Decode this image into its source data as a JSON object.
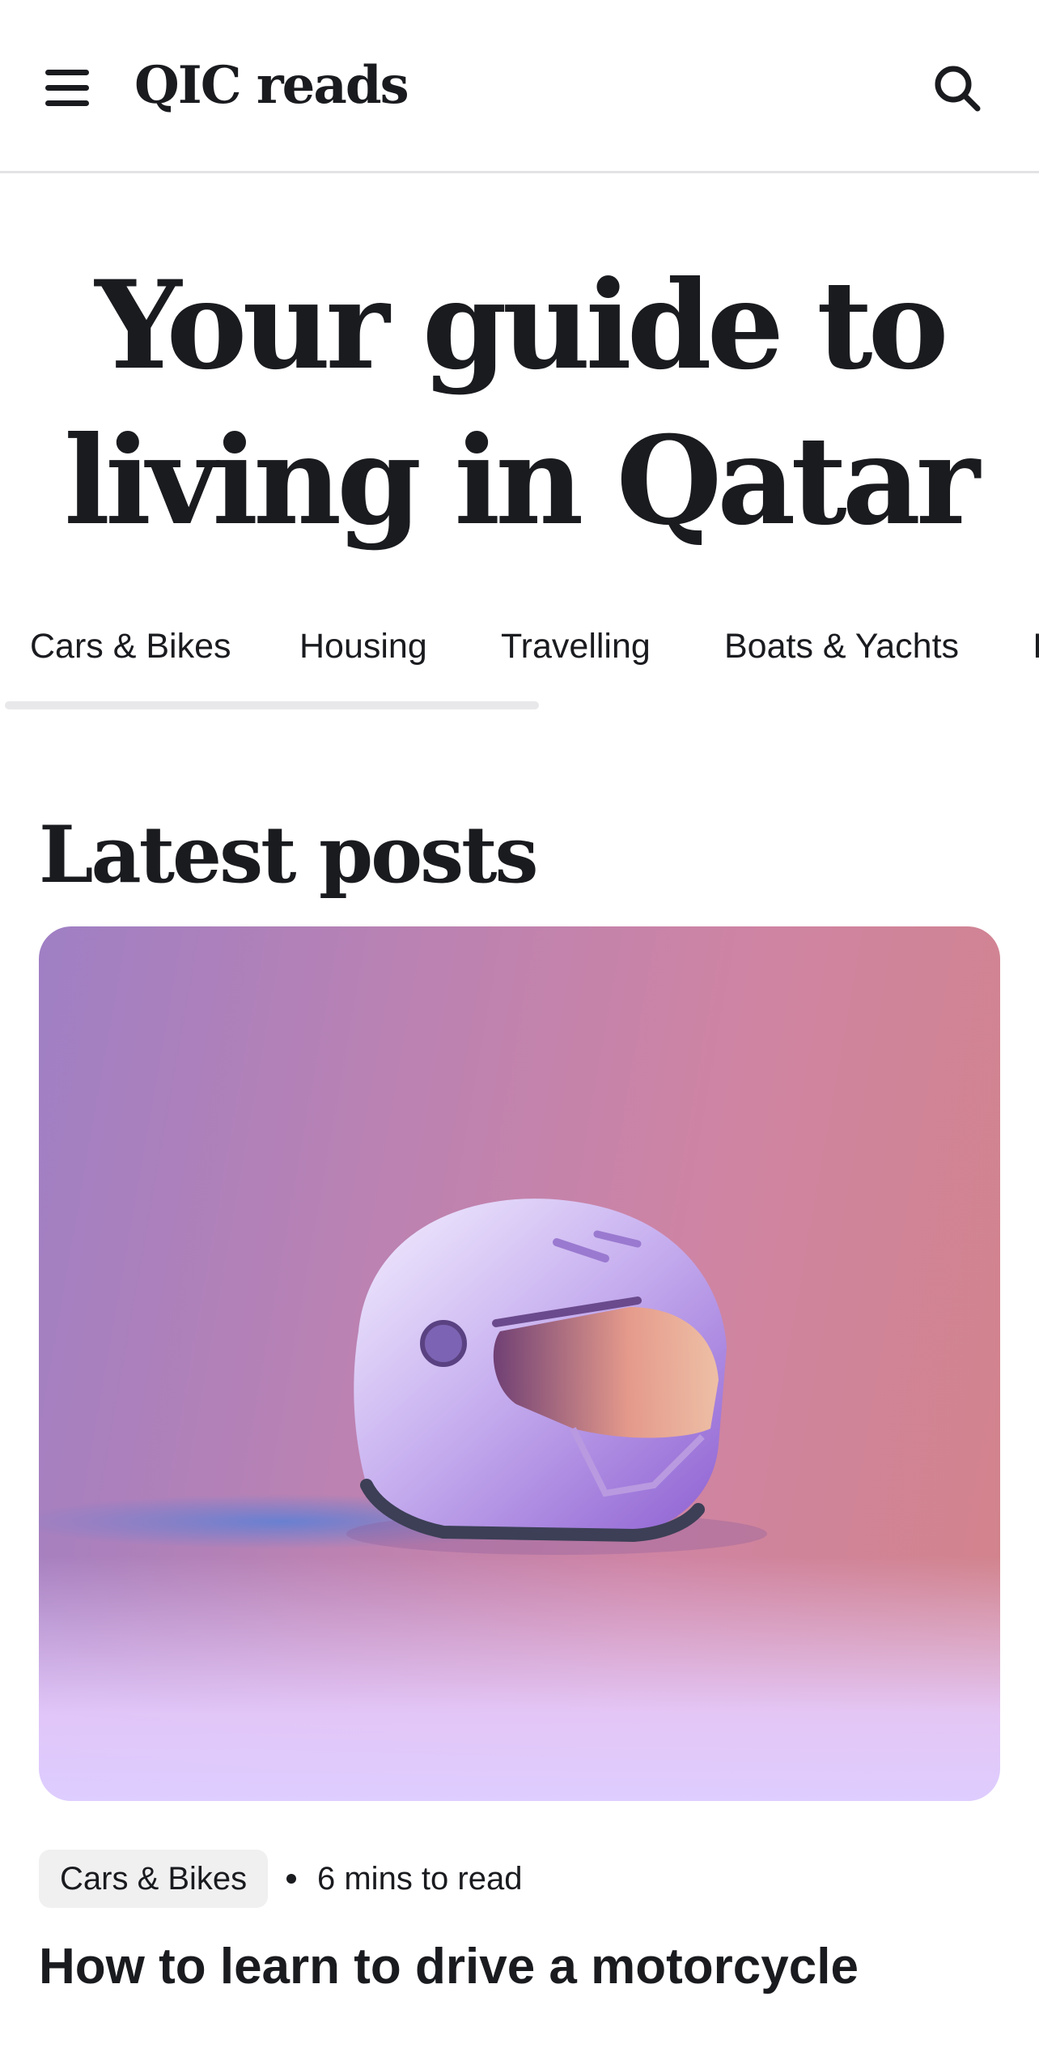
{
  "header": {
    "brand": "QIC reads",
    "menu_icon": "hamburger-menu-icon",
    "search_icon": "search-icon"
  },
  "hero": {
    "title_line1": "Your guide to",
    "title_line2": "living in Qatar"
  },
  "tabs": [
    {
      "label": "Cars & Bikes"
    },
    {
      "label": "Housing"
    },
    {
      "label": "Travelling"
    },
    {
      "label": "Boats & Yachts"
    },
    {
      "label": "I"
    }
  ],
  "latest": {
    "title": "Latest posts"
  },
  "posts": [
    {
      "image": "motorcycle-helmet-image",
      "category": "Cars & Bikes",
      "read_time": "6 mins to read",
      "title": "How to learn to drive a motorcycle"
    }
  ],
  "colors": {
    "text": "#1a1b1f",
    "divider": "#e3e3e5",
    "chip_bg": "#f0f0f1",
    "card_gradient_start": "#9f7fc4",
    "card_gradient_end": "#d2838a"
  }
}
